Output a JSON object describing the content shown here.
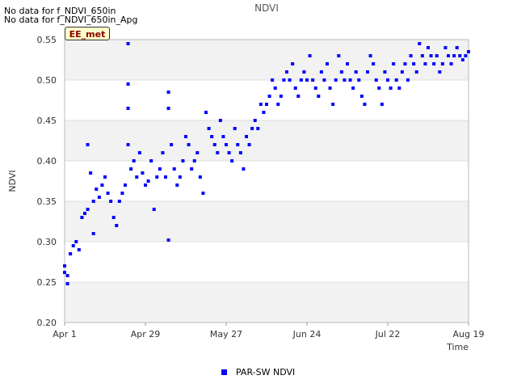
{
  "notices": [
    "No data for f_NDVI_650in",
    "No data for f_NDVI_650in_Apg"
  ],
  "site_badge": "EE_met",
  "colors": {
    "series": "#0000ff",
    "band": "#f2f2f2",
    "grid": "#dddddd",
    "axis": "#bbbbbb"
  },
  "chart_data": {
    "type": "scatter",
    "title": "NDVI",
    "xlabel": "Time",
    "ylabel": "NDVI",
    "xlim": [
      "2022-04-01",
      "2022-08-19"
    ],
    "ylim": [
      0.2,
      0.55
    ],
    "xticks": [
      {
        "date": "2022-04-01",
        "label": "Apr 1"
      },
      {
        "date": "2022-04-29",
        "label": "Apr 29"
      },
      {
        "date": "2022-05-27",
        "label": "May 27"
      },
      {
        "date": "2022-06-24",
        "label": "Jun 24"
      },
      {
        "date": "2022-07-22",
        "label": "Jul 22"
      },
      {
        "date": "2022-08-19",
        "label": "Aug 19"
      }
    ],
    "yticks": [
      "0.20",
      "0.25",
      "0.30",
      "0.35",
      "0.40",
      "0.45",
      "0.50",
      "0.55"
    ],
    "grid": true,
    "legend_position": "bottom",
    "series": [
      {
        "name": "PAR-SW NDVI",
        "points": [
          [
            "2022-04-01",
            0.27
          ],
          [
            "2022-04-01",
            0.262
          ],
          [
            "2022-04-02",
            0.248
          ],
          [
            "2022-04-02",
            0.258
          ],
          [
            "2022-04-03",
            0.285
          ],
          [
            "2022-04-04",
            0.295
          ],
          [
            "2022-04-05",
            0.3
          ],
          [
            "2022-04-06",
            0.29
          ],
          [
            "2022-04-07",
            0.33
          ],
          [
            "2022-04-08",
            0.335
          ],
          [
            "2022-04-09",
            0.34
          ],
          [
            "2022-04-09",
            0.42
          ],
          [
            "2022-04-10",
            0.385
          ],
          [
            "2022-04-11",
            0.35
          ],
          [
            "2022-04-11",
            0.31
          ],
          [
            "2022-04-12",
            0.365
          ],
          [
            "2022-04-13",
            0.355
          ],
          [
            "2022-04-14",
            0.37
          ],
          [
            "2022-04-15",
            0.38
          ],
          [
            "2022-04-16",
            0.36
          ],
          [
            "2022-04-17",
            0.35
          ],
          [
            "2022-04-18",
            0.33
          ],
          [
            "2022-04-19",
            0.32
          ],
          [
            "2022-04-20",
            0.35
          ],
          [
            "2022-04-21",
            0.36
          ],
          [
            "2022-04-22",
            0.37
          ],
          [
            "2022-04-23",
            0.545
          ],
          [
            "2022-04-23",
            0.495
          ],
          [
            "2022-04-23",
            0.465
          ],
          [
            "2022-04-23",
            0.42
          ],
          [
            "2022-04-24",
            0.39
          ],
          [
            "2022-04-25",
            0.4
          ],
          [
            "2022-04-26",
            0.38
          ],
          [
            "2022-04-27",
            0.41
          ],
          [
            "2022-04-28",
            0.385
          ],
          [
            "2022-04-29",
            0.37
          ],
          [
            "2022-04-30",
            0.375
          ],
          [
            "2022-05-01",
            0.4
          ],
          [
            "2022-05-02",
            0.34
          ],
          [
            "2022-05-03",
            0.38
          ],
          [
            "2022-05-04",
            0.39
          ],
          [
            "2022-05-05",
            0.41
          ],
          [
            "2022-05-06",
            0.38
          ],
          [
            "2022-05-07",
            0.485
          ],
          [
            "2022-05-07",
            0.465
          ],
          [
            "2022-05-07",
            0.302
          ],
          [
            "2022-05-08",
            0.42
          ],
          [
            "2022-05-09",
            0.39
          ],
          [
            "2022-05-10",
            0.37
          ],
          [
            "2022-05-11",
            0.38
          ],
          [
            "2022-05-12",
            0.4
          ],
          [
            "2022-05-13",
            0.43
          ],
          [
            "2022-05-14",
            0.42
          ],
          [
            "2022-05-15",
            0.39
          ],
          [
            "2022-05-16",
            0.4
          ],
          [
            "2022-05-17",
            0.41
          ],
          [
            "2022-05-18",
            0.38
          ],
          [
            "2022-05-19",
            0.36
          ],
          [
            "2022-05-20",
            0.46
          ],
          [
            "2022-05-21",
            0.44
          ],
          [
            "2022-05-22",
            0.43
          ],
          [
            "2022-05-23",
            0.42
          ],
          [
            "2022-05-24",
            0.41
          ],
          [
            "2022-05-25",
            0.45
          ],
          [
            "2022-05-26",
            0.43
          ],
          [
            "2022-05-27",
            0.42
          ],
          [
            "2022-05-28",
            0.41
          ],
          [
            "2022-05-29",
            0.4
          ],
          [
            "2022-05-30",
            0.44
          ],
          [
            "2022-05-31",
            0.42
          ],
          [
            "2022-06-01",
            0.41
          ],
          [
            "2022-06-02",
            0.39
          ],
          [
            "2022-06-03",
            0.43
          ],
          [
            "2022-06-04",
            0.42
          ],
          [
            "2022-06-05",
            0.44
          ],
          [
            "2022-06-06",
            0.45
          ],
          [
            "2022-06-07",
            0.44
          ],
          [
            "2022-06-08",
            0.47
          ],
          [
            "2022-06-09",
            0.46
          ],
          [
            "2022-06-10",
            0.47
          ],
          [
            "2022-06-11",
            0.48
          ],
          [
            "2022-06-12",
            0.5
          ],
          [
            "2022-06-13",
            0.49
          ],
          [
            "2022-06-14",
            0.47
          ],
          [
            "2022-06-15",
            0.48
          ],
          [
            "2022-06-16",
            0.5
          ],
          [
            "2022-06-17",
            0.51
          ],
          [
            "2022-06-18",
            0.5
          ],
          [
            "2022-06-19",
            0.52
          ],
          [
            "2022-06-20",
            0.49
          ],
          [
            "2022-06-21",
            0.48
          ],
          [
            "2022-06-22",
            0.5
          ],
          [
            "2022-06-23",
            0.51
          ],
          [
            "2022-06-24",
            0.5
          ],
          [
            "2022-06-25",
            0.53
          ],
          [
            "2022-06-26",
            0.5
          ],
          [
            "2022-06-27",
            0.49
          ],
          [
            "2022-06-28",
            0.48
          ],
          [
            "2022-06-29",
            0.51
          ],
          [
            "2022-06-30",
            0.5
          ],
          [
            "2022-07-01",
            0.52
          ],
          [
            "2022-07-02",
            0.49
          ],
          [
            "2022-07-03",
            0.47
          ],
          [
            "2022-07-04",
            0.5
          ],
          [
            "2022-07-05",
            0.53
          ],
          [
            "2022-07-06",
            0.51
          ],
          [
            "2022-07-07",
            0.5
          ],
          [
            "2022-07-08",
            0.52
          ],
          [
            "2022-07-09",
            0.5
          ],
          [
            "2022-07-10",
            0.49
          ],
          [
            "2022-07-11",
            0.51
          ],
          [
            "2022-07-12",
            0.5
          ],
          [
            "2022-07-13",
            0.48
          ],
          [
            "2022-07-14",
            0.47
          ],
          [
            "2022-07-15",
            0.51
          ],
          [
            "2022-07-16",
            0.53
          ],
          [
            "2022-07-17",
            0.52
          ],
          [
            "2022-07-18",
            0.5
          ],
          [
            "2022-07-19",
            0.49
          ],
          [
            "2022-07-20",
            0.47
          ],
          [
            "2022-07-21",
            0.51
          ],
          [
            "2022-07-22",
            0.5
          ],
          [
            "2022-07-23",
            0.49
          ],
          [
            "2022-07-24",
            0.52
          ],
          [
            "2022-07-25",
            0.5
          ],
          [
            "2022-07-26",
            0.49
          ],
          [
            "2022-07-27",
            0.51
          ],
          [
            "2022-07-28",
            0.52
          ],
          [
            "2022-07-29",
            0.5
          ],
          [
            "2022-07-30",
            0.53
          ],
          [
            "2022-07-31",
            0.52
          ],
          [
            "2022-08-01",
            0.51
          ],
          [
            "2022-08-02",
            0.545
          ],
          [
            "2022-08-03",
            0.53
          ],
          [
            "2022-08-04",
            0.52
          ],
          [
            "2022-08-05",
            0.54
          ],
          [
            "2022-08-06",
            0.53
          ],
          [
            "2022-08-07",
            0.52
          ],
          [
            "2022-08-08",
            0.53
          ],
          [
            "2022-08-09",
            0.51
          ],
          [
            "2022-08-10",
            0.52
          ],
          [
            "2022-08-11",
            0.54
          ],
          [
            "2022-08-12",
            0.53
          ],
          [
            "2022-08-13",
            0.52
          ],
          [
            "2022-08-14",
            0.53
          ],
          [
            "2022-08-15",
            0.54
          ],
          [
            "2022-08-16",
            0.53
          ],
          [
            "2022-08-17",
            0.525
          ],
          [
            "2022-08-18",
            0.53
          ],
          [
            "2022-08-19",
            0.535
          ]
        ]
      }
    ]
  }
}
